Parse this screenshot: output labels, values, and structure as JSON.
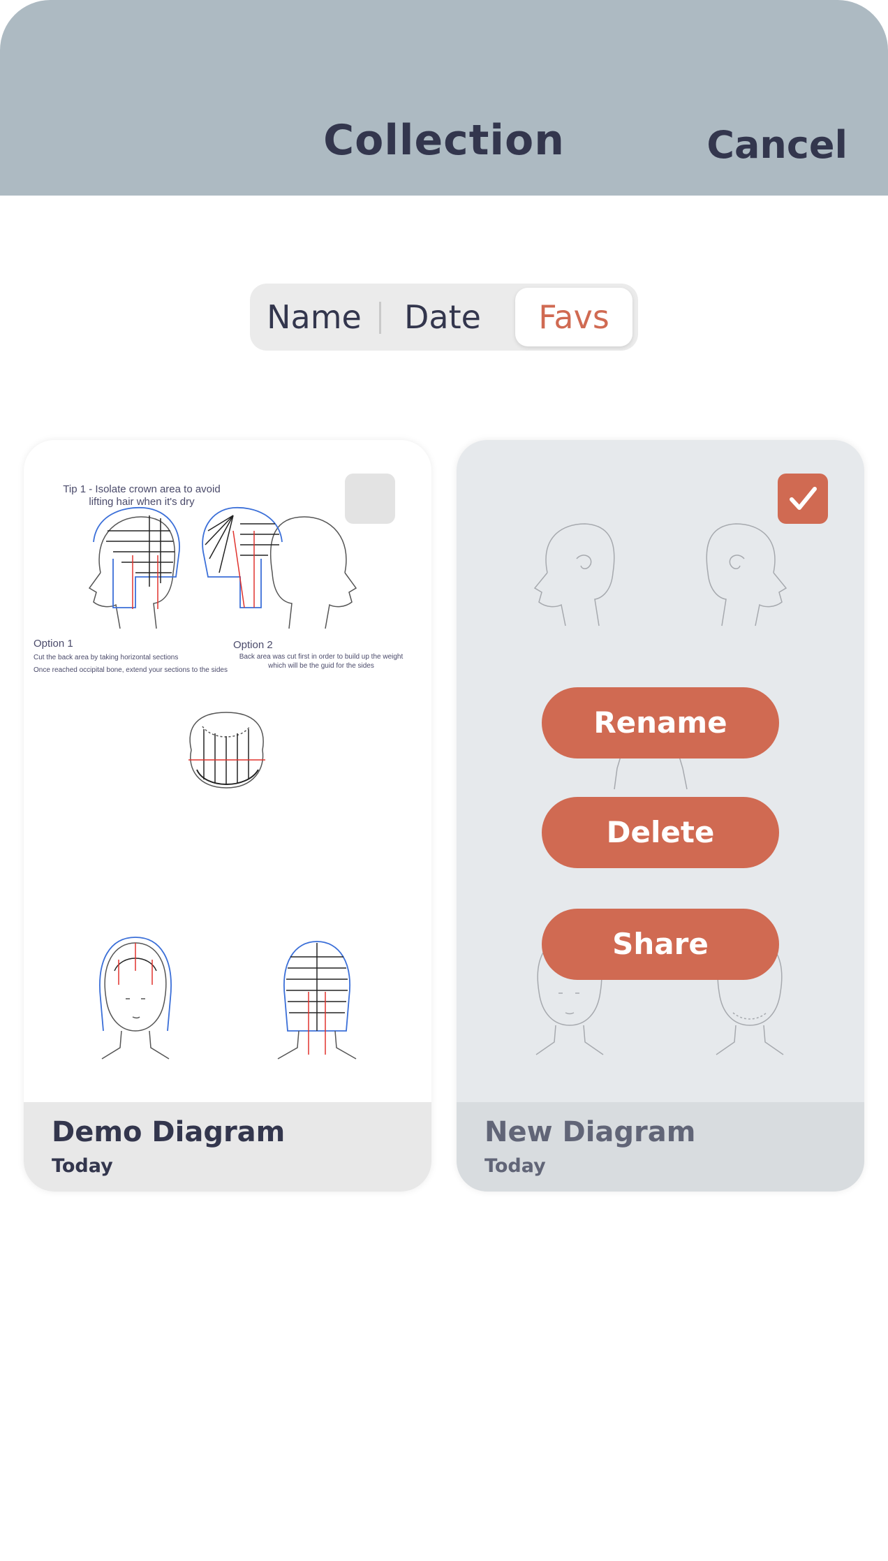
{
  "header": {
    "title": "Collection",
    "cancel_label": "Cancel"
  },
  "sort": {
    "options": [
      "Name",
      "Date",
      "Favs"
    ],
    "selected": "Favs"
  },
  "cards": [
    {
      "title": "Demo Diagram",
      "date": "Today",
      "checked": false,
      "notes": {
        "tip1_line1": "Tip 1 - Isolate crown area to avoid",
        "tip1_line2": "lifting hair when it's dry",
        "option1_title": "Option 1",
        "option1_line1": "Cut the back area by taking horizontal sections",
        "option1_line2": "Once reached occipital bone, extend your sections to the sides",
        "option2_title": "Option 2",
        "option2_line1": "Back area was cut first in order to build up the weight",
        "option2_line2": "which will be the guid for the sides"
      }
    },
    {
      "title": "New Diagram",
      "date": "Today",
      "checked": true,
      "actions": [
        "Rename",
        "Delete",
        "Share"
      ]
    }
  ],
  "colors": {
    "header_bg": "#adbac2",
    "accent": "#d06a52",
    "text_dark": "#33364d",
    "card_selected_bg": "#e6e9ec"
  },
  "icons": {
    "checkbox_checked": "checkmark-icon"
  }
}
